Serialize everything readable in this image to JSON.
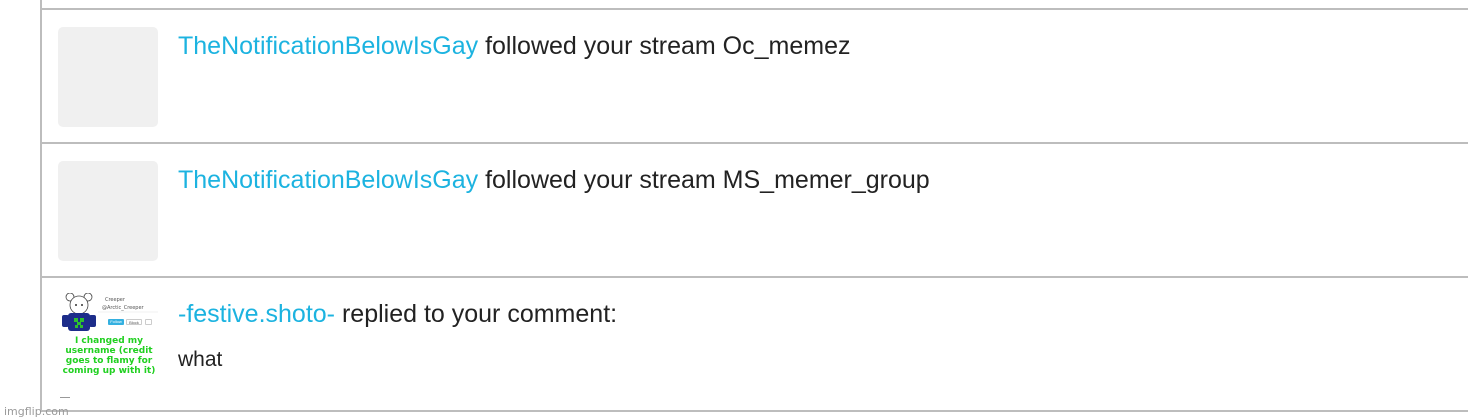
{
  "notifications": [
    {
      "username": "TheNotificationBelowIsGay",
      "action": " followed your stream Oc_memez"
    },
    {
      "username": "TheNotificationBelowIsGay",
      "action": " followed your stream MS_memer_group"
    },
    {
      "username": "-festive.shoto-",
      "action": " replied to your comment:",
      "reply_text": "what",
      "thumbnail": {
        "name": "Creeper",
        "handle": "@Arctic_Creeper",
        "btn_follow": "Follow",
        "btn_block": "Block",
        "caption": "I changed my username (credit goes to flamy for coming up with it)"
      }
    }
  ],
  "watermark": "imgflip.com",
  "colors": {
    "username": "#1cb3e0",
    "divider": "#bdbdbd",
    "avatar_bg": "#f0f0f0",
    "caption_green": "#21d021"
  }
}
